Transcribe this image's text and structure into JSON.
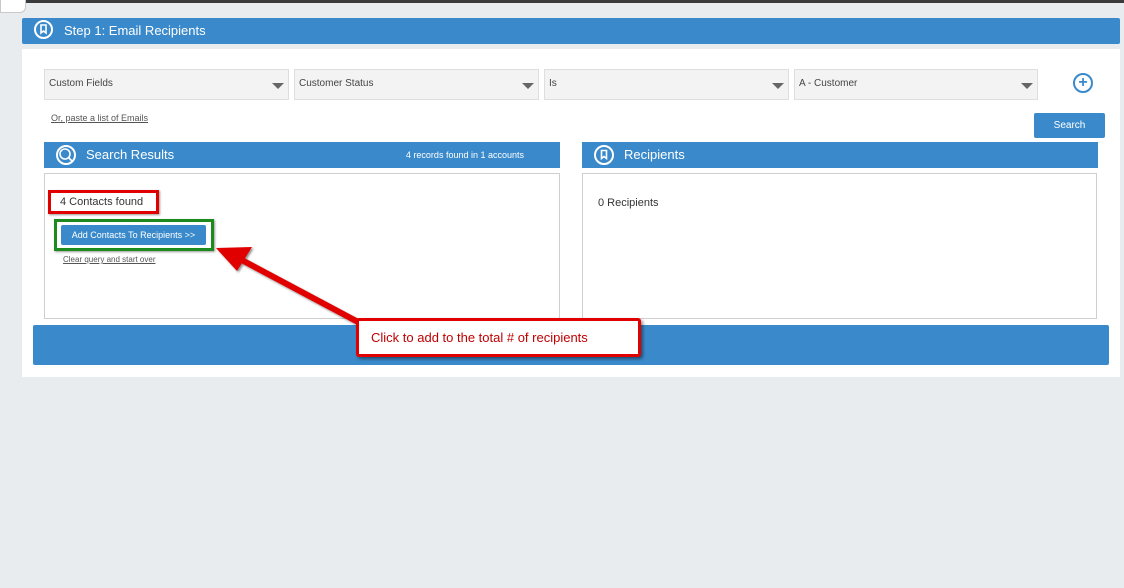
{
  "step": {
    "title": "Step 1: Email Recipients"
  },
  "filters": {
    "field": "Custom Fields",
    "subfield": "Customer Status",
    "operator": "Is",
    "value": "A - Customer"
  },
  "paste_link": "Or, paste a list of Emails",
  "search_button": "Search",
  "search_results": {
    "title": "Search Results",
    "records_summary": "4 records found in 1 accounts",
    "contacts_found": "4 Contacts found",
    "add_button": "Add Contacts To Recipients >>",
    "clear_link": "Clear query and start over"
  },
  "recipients": {
    "title": "Recipients",
    "count_text": "0 Recipients"
  },
  "annotation": {
    "callout_text": "Click to add to the total # of recipients"
  },
  "colors": {
    "accent": "#3a8acb",
    "annotation_red": "#e00000",
    "annotation_green": "#1d8a1d"
  },
  "icons": {
    "step": "ribbon-icon",
    "search": "search-icon",
    "recipients": "ribbon-icon",
    "add_filter": "plus-circle-icon"
  }
}
